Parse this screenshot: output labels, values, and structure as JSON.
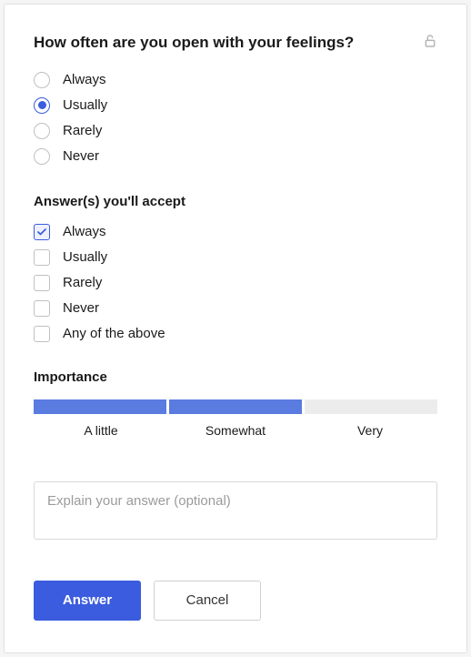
{
  "question": {
    "title": "How often are you open with your feelings?",
    "privacy_icon": "unlocked"
  },
  "answers": {
    "options": [
      {
        "label": "Always",
        "selected": false
      },
      {
        "label": "Usually",
        "selected": true
      },
      {
        "label": "Rarely",
        "selected": false
      },
      {
        "label": "Never",
        "selected": false
      }
    ]
  },
  "accept": {
    "title": "Answer(s) you'll accept",
    "options": [
      {
        "label": "Always",
        "checked": true
      },
      {
        "label": "Usually",
        "checked": false
      },
      {
        "label": "Rarely",
        "checked": false
      },
      {
        "label": "Never",
        "checked": false
      },
      {
        "label": "Any of the above",
        "checked": false
      }
    ]
  },
  "importance": {
    "title": "Importance",
    "level": 2,
    "labels": [
      "A little",
      "Somewhat",
      "Very"
    ]
  },
  "explain": {
    "placeholder": "Explain your answer (optional)",
    "value": ""
  },
  "buttons": {
    "primary": "Answer",
    "secondary": "Cancel"
  }
}
